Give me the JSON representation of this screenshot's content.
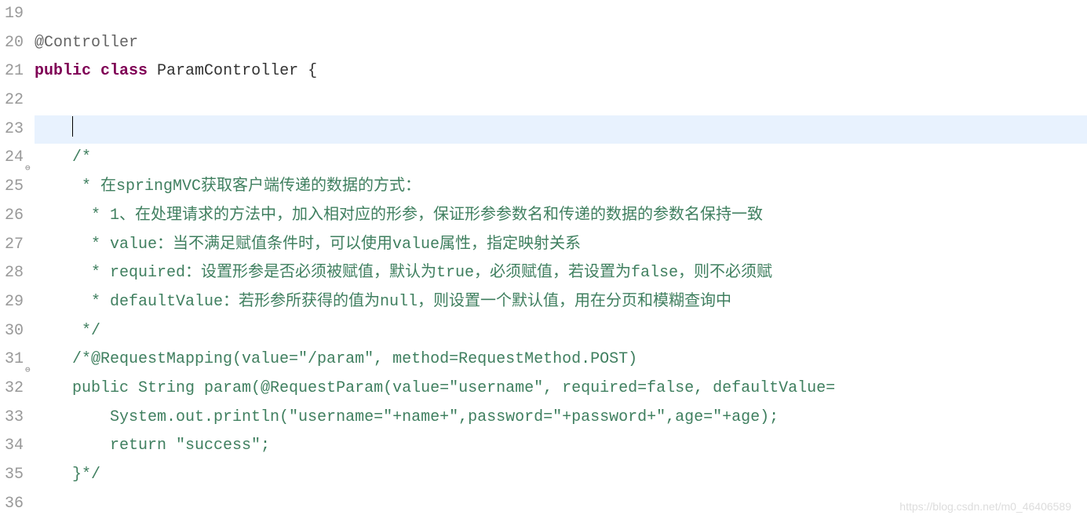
{
  "lineNumbers": [
    "19",
    "20",
    "21",
    "22",
    "23",
    "24",
    "25",
    "26",
    "27",
    "28",
    "29",
    "30",
    "31",
    "32",
    "33",
    "34",
    "35",
    "36"
  ],
  "foldMarkers": {
    "24": "⊖",
    "31": "⊖"
  },
  "currentLine": 5,
  "code": {
    "l20_ann": "@Controller",
    "l21_kw1": "public",
    "l21_kw2": "class",
    "l21_rest": " ParamController {",
    "l24": "    /*",
    "l25": "     * 在springMVC获取客户端传递的数据的方式：",
    "l26": "      * 1、在处理请求的方法中，加入相对应的形参，保证形参参数名和传递的数据的参数名保持一致",
    "l27": "      * value：当不满足赋值条件时，可以使用value属性，指定映射关系",
    "l28": "      * required：设置形参是否必须被赋值，默认为true，必须赋值，若设置为false，则不必须赋",
    "l29": "      * defaultValue：若形参所获得的值为null，则设置一个默认值，用在分页和模糊查询中",
    "l30": "     */",
    "l31": "    /*@RequestMapping(value=\"/param\", method=RequestMethod.POST)",
    "l32": "    public String param(@RequestParam(value=\"username\", required=false, defaultValue=",
    "l33": "        System.out.println(\"username=\"+name+\",password=\"+password+\",age=\"+age);",
    "l34": "        return \"success\";",
    "l35": "    }*/"
  },
  "watermark": "https://blog.csdn.net/m0_46406589"
}
